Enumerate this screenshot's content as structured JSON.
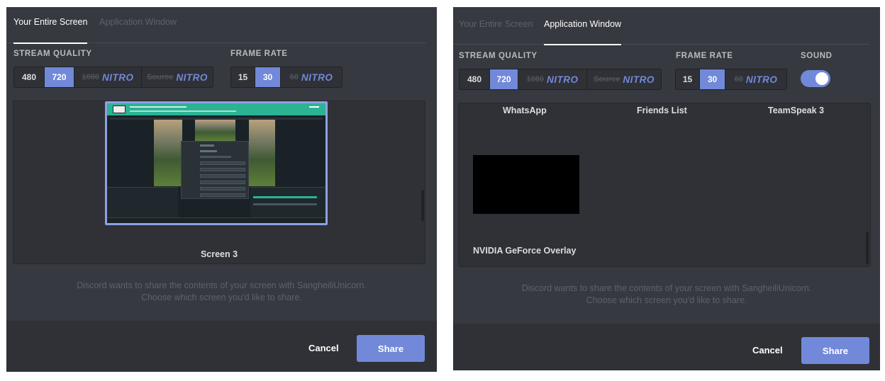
{
  "left": {
    "tabs": [
      {
        "label": "Your Entire Screen",
        "active": true
      },
      {
        "label": "Application Window",
        "active": false
      }
    ],
    "stream_quality_label": "STREAM QUALITY",
    "frame_rate_label": "FRAME RATE",
    "quality_options": [
      {
        "label": "480",
        "selected": false
      },
      {
        "label": "720",
        "selected": true
      },
      {
        "label": "1080",
        "badge": "NITRO",
        "locked": true
      },
      {
        "label": "Source",
        "badge": "NITRO",
        "locked": true
      }
    ],
    "frame_options": [
      {
        "label": "15",
        "selected": false
      },
      {
        "label": "30",
        "selected": true
      },
      {
        "label": "60",
        "badge": "NITRO",
        "locked": true
      }
    ],
    "source": {
      "name": "Screen 3"
    },
    "description_line1": "Discord wants to share the contents of your screen with SangheiliUnicorn.",
    "description_line2": "Choose which screen you'd like to share.",
    "cancel_label": "Cancel",
    "share_label": "Share"
  },
  "right": {
    "tabs": [
      {
        "label": "Your Entire Screen",
        "active": false
      },
      {
        "label": "Application Window",
        "active": true
      }
    ],
    "stream_quality_label": "STREAM QUALITY",
    "frame_rate_label": "FRAME RATE",
    "sound_label": "SOUND",
    "sound_enabled": true,
    "quality_options": [
      {
        "label": "480",
        "selected": false
      },
      {
        "label": "720",
        "selected": true
      },
      {
        "label": "1080",
        "badge": "NITRO",
        "locked": true
      },
      {
        "label": "Source",
        "badge": "NITRO",
        "locked": true
      }
    ],
    "frame_options": [
      {
        "label": "15",
        "selected": false
      },
      {
        "label": "30",
        "selected": true
      },
      {
        "label": "60",
        "badge": "NITRO",
        "locked": true
      }
    ],
    "sources": [
      {
        "name": "WhatsApp"
      },
      {
        "name": "Friends List"
      },
      {
        "name": "TeamSpeak 3"
      },
      {
        "name": "NVIDIA GeForce Overlay"
      }
    ],
    "description_line1": "Discord wants to share the contents of your screen with SangheiliUnicorn.",
    "description_line2": "Choose which screen you'd like to share.",
    "cancel_label": "Cancel",
    "share_label": "Share"
  },
  "colors": {
    "panel_bg": "#36393f",
    "footer_bg": "#2f3136",
    "accent": "#7289da",
    "muted_text": "#5e626a"
  }
}
